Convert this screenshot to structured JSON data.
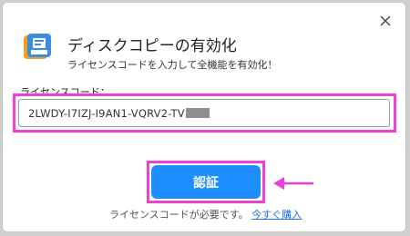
{
  "dialog": {
    "title": "ディスクコピーの有効化",
    "subtitle": "ライセンスコードを入力して全機能を有効化！",
    "license_label": "ライセンスコード：",
    "license_value": "2LWDY-I7IZJ-I9AN1-VQRV2-TV",
    "activate_button": "認証",
    "footer_text": "ライセンスコードが必要です。",
    "buy_link": "今すぐ購入"
  },
  "icons": {
    "close": "close-icon",
    "app": "disk-copy-app-icon",
    "arrow": "left-arrow-icon"
  },
  "colors": {
    "accent": "#1e8dff",
    "highlight": "#ee3fd6",
    "link": "#1e6fd9"
  }
}
